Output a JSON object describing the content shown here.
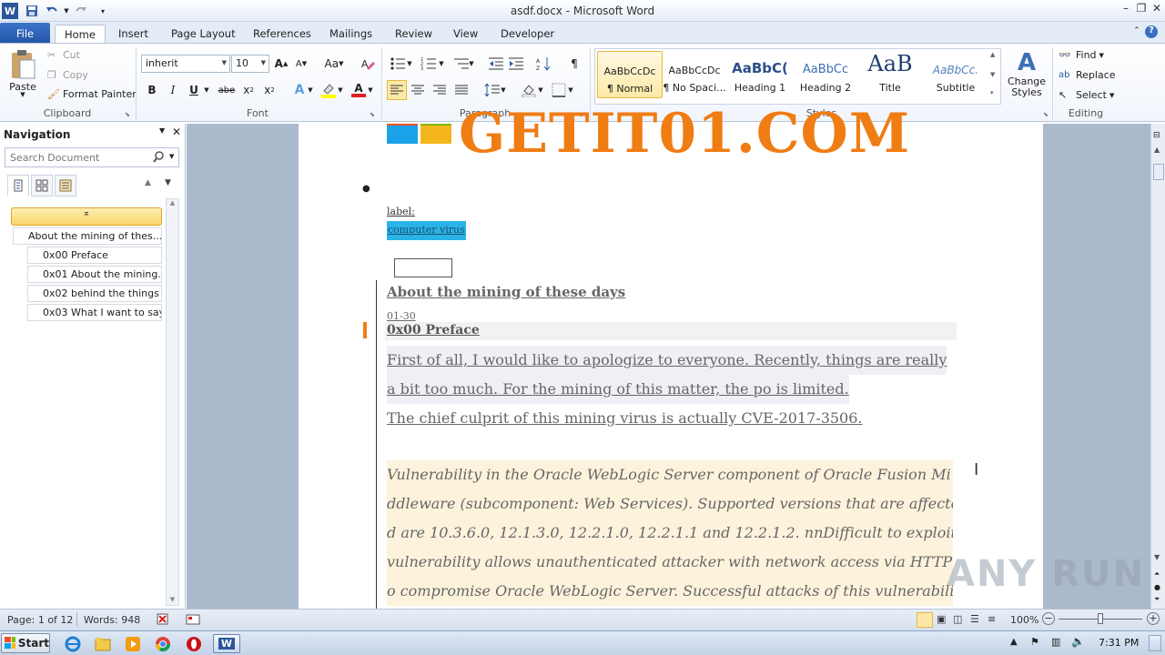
{
  "window": {
    "title": "asdf.docx - Microsoft Word",
    "app_icon": "word-icon"
  },
  "tabs": [
    "File",
    "Home",
    "Insert",
    "Page Layout",
    "References",
    "Mailings",
    "Review",
    "View",
    "Developer"
  ],
  "ribbon": {
    "clipboard": {
      "label": "Clipboard",
      "paste": "Paste",
      "cut": "Cut",
      "copy": "Copy",
      "format_painter": "Format Painter"
    },
    "font": {
      "label": "Font",
      "font_name": "inherit",
      "font_size": "10",
      "grow_glyph": "A",
      "shrink_glyph": "A",
      "case_glyph": "Aa",
      "bold": "B",
      "italic": "I",
      "underline": "U",
      "strike": "abe",
      "sub": "x",
      "super": "x",
      "color_glyph": "A"
    },
    "paragraph": {
      "label": "Paragraph",
      "pilcrow": "¶"
    },
    "styles": {
      "label": "Styles",
      "items": [
        {
          "sample": "AaBbCcDc",
          "name": "¶ Normal"
        },
        {
          "sample": "AaBbCcDc",
          "name": "¶ No Spaci..."
        },
        {
          "sample": "AaBbC(",
          "name": "Heading 1"
        },
        {
          "sample": "AaBbCc",
          "name": "Heading 2"
        },
        {
          "sample": "AaB",
          "name": "Title"
        },
        {
          "sample": "AaBbCc.",
          "name": "Subtitle"
        }
      ],
      "change_styles": "Change Styles"
    },
    "editing": {
      "label": "Editing",
      "find": "Find",
      "replace": "Replace",
      "select": "Select"
    }
  },
  "navigation": {
    "title": "Navigation",
    "search_placeholder": "Search Document",
    "headings": [
      "About the mining of thes...",
      "0x00 Preface",
      "0x01 About the mining...",
      "0x02 behind the things",
      "0x03 What I want to say"
    ]
  },
  "document": {
    "logo_text": "GETIT01.COM",
    "label_text": "label:",
    "tag_text": "computer virus",
    "heading": "About the mining of these days",
    "date": "01-30",
    "subheading": "0x00 Preface",
    "paragraph_lines": [
      "First of all, I would like to apologize to everyone. Recently, things  are really",
      "a bit too much.  For the mining  of this matter, the po is limited.",
      "The  chief culprit of this mining  virus is actually CVE-2017-3506."
    ],
    "quote_lines": [
      "Vulnerability in the Oracle WebLogic Server component of Oracle Fusion Mi",
      "ddleware (subcomponent: Web Services). Supported versions that are affecte",
      "d are 10.3.6.0, 12.1.3.0, 12.2.1.0, 12.2.1.1 and 12.2.1.2. nnDifficult to exploit",
      "vulnerability allows unauthenticated attacker with network access via HTTP t",
      "o compromise Oracle WebLogic Server. Successful attacks of this vulnerabili"
    ]
  },
  "status": {
    "page": "Page: 1 of 12",
    "words": "Words: 948",
    "zoom": "100%"
  },
  "taskbar": {
    "start": "Start",
    "time": "7:31 PM"
  },
  "watermark": "ANY RUN",
  "colors": {
    "file_tab": "#2b579a",
    "tag_bg": "#2ab3e6",
    "logo_orange": "#f07c14",
    "quote_bg": "#fdf3dc",
    "selected_style": "#fde9a7"
  }
}
